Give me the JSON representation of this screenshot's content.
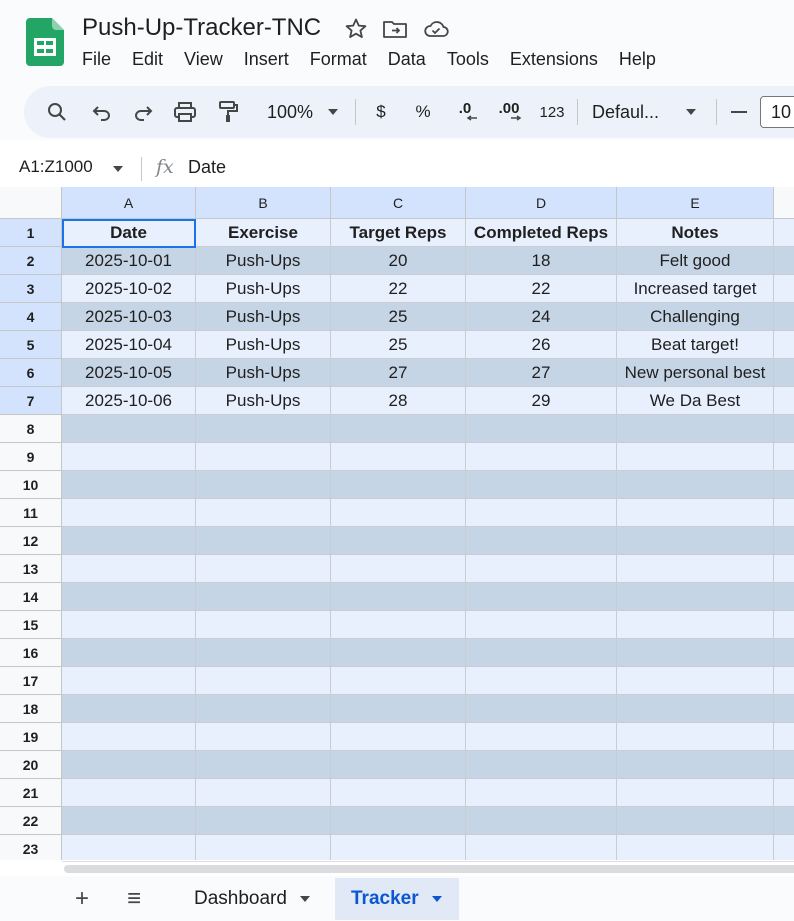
{
  "app": {
    "brand_color": "#23a566"
  },
  "document": {
    "title": "Push-Up-Tracker-TNC"
  },
  "menu": [
    "File",
    "Edit",
    "View",
    "Insert",
    "Format",
    "Data",
    "Tools",
    "Extensions",
    "Help"
  ],
  "toolbar": {
    "zoom": "100%",
    "currency": "$",
    "percent": "%",
    "decrease_decimal": ".0",
    "increase_decimal": ".00",
    "number_format": "123",
    "font": "Defaul...",
    "font_size": "10",
    "icons": [
      "search-icon",
      "undo-icon",
      "redo-icon",
      "print-icon",
      "paint-format-icon"
    ]
  },
  "formula_bar": {
    "range": "A1:Z1000",
    "fx": "fx",
    "content": "Date"
  },
  "columns": [
    "A",
    "B",
    "C",
    "D",
    "E"
  ],
  "rows": [
    "1",
    "2",
    "3",
    "4",
    "5",
    "6",
    "7",
    "8",
    "9",
    "10",
    "11",
    "12",
    "13",
    "14",
    "15",
    "16",
    "17",
    "18",
    "19",
    "20",
    "21",
    "22",
    "23"
  ],
  "table": {
    "headers": [
      "Date",
      "Exercise",
      "Target Reps",
      "Completed Reps",
      "Notes"
    ],
    "rows": [
      [
        "2025-10-01",
        "Push-Ups",
        "20",
        "18",
        "Felt good"
      ],
      [
        "2025-10-02",
        "Push-Ups",
        "22",
        "22",
        "Increased target"
      ],
      [
        "2025-10-03",
        "Push-Ups",
        "25",
        "24",
        "Challenging"
      ],
      [
        "2025-10-04",
        "Push-Ups",
        "25",
        "26",
        "Beat target!"
      ],
      [
        "2025-10-05",
        "Push-Ups",
        "27",
        "27",
        "New personal best"
      ],
      [
        "2025-10-06",
        "Push-Ups",
        "28",
        "29",
        "We Da Best"
      ]
    ]
  },
  "band_colors": {
    "light": "#e8f0fe",
    "dark": "#c5d5e5",
    "selection": "#1a73e8"
  },
  "sheets": {
    "add": "+",
    "all_sheets": "≡",
    "tabs": [
      {
        "label": "Dashboard",
        "active": false
      },
      {
        "label": "Tracker",
        "active": true
      }
    ]
  }
}
